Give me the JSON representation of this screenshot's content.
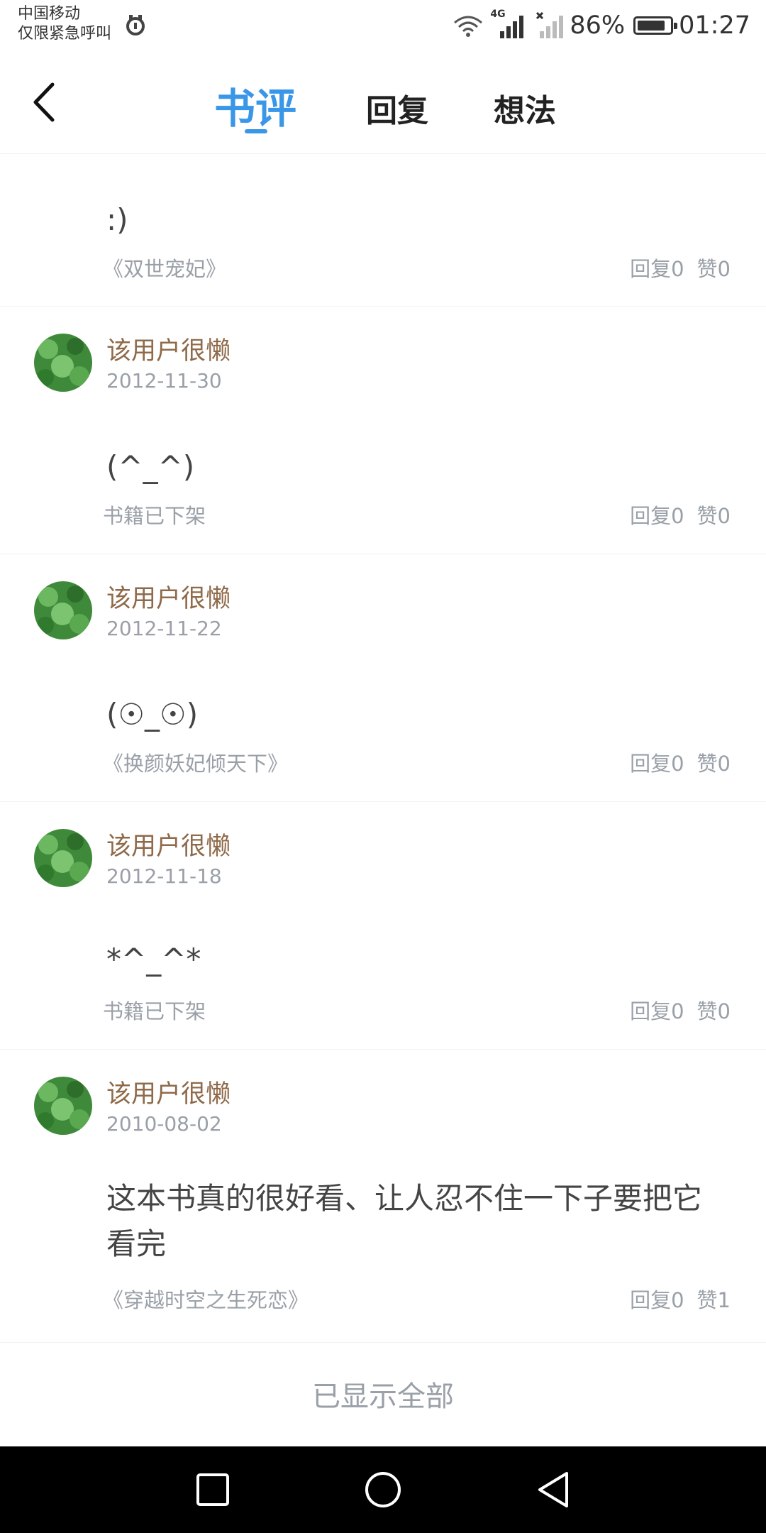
{
  "status_bar": {
    "carrier": "中国移动",
    "carrier_sub": "仅限紧急呼叫",
    "network": "4G",
    "battery_pct": "86%",
    "battery_level": 0.86,
    "time": "01:27"
  },
  "header": {
    "tabs": [
      {
        "label": "书评",
        "active": true
      },
      {
        "label": "回复",
        "active": false
      },
      {
        "label": "想法",
        "active": false
      }
    ],
    "accent_color": "#3a97e8"
  },
  "reviews": [
    {
      "content": ":)",
      "book": "《双世宠妃》",
      "replies": "回复0",
      "likes": "赞0"
    },
    {
      "user": "该用户很懒",
      "date": "2012-11-30",
      "content": "(^_^)",
      "book": "书籍已下架",
      "replies": "回复0",
      "likes": "赞0"
    },
    {
      "user": "该用户很懒",
      "date": "2012-11-22",
      "content": "(☉_☉)",
      "book": "《换颜妖妃倾天下》",
      "replies": "回复0",
      "likes": "赞0"
    },
    {
      "user": "该用户很懒",
      "date": "2012-11-18",
      "content": "*^_^*",
      "book": "书籍已下架",
      "replies": "回复0",
      "likes": "赞0"
    },
    {
      "user": "该用户很懒",
      "date": "2010-08-02",
      "content": "这本书真的很好看、让人忍不住一下子要把它看完",
      "book": "《穿越时空之生死恋》",
      "replies": "回复0",
      "likes": "赞1"
    }
  ],
  "footer": {
    "text": "已显示全部"
  }
}
